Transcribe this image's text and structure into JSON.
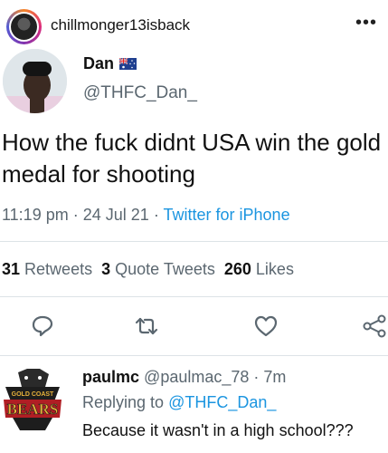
{
  "instagram": {
    "username": "chillmonger13isback",
    "more_icon": "more-horizontal-icon"
  },
  "tweet": {
    "name": "Dan",
    "flag": "australia-flag",
    "handle": "@THFC_Dan_",
    "text": "How the fuck didnt USA win the gold medal for shooting",
    "time": "11:19 pm",
    "sep1": "·",
    "date": "24 Jul 21",
    "sep2": "·",
    "source": "Twitter for iPhone",
    "retweets_count": "31",
    "retweets_label": "Retweets",
    "quotes_count": "3",
    "quotes_label": "Quote Tweets",
    "likes_count": "260",
    "likes_label": "Likes"
  },
  "actions": [
    "reply-icon",
    "retweet-icon",
    "like-icon",
    "share-icon"
  ],
  "reply": {
    "name": "paulmc",
    "handle": "@paulmac_78",
    "sep": "·",
    "time": "7m",
    "replying_prefix": "Replying to",
    "replying_to": "@THFC_Dan_",
    "text": "Because it wasn't in a high school???",
    "avatar_text_top": "GOLD COAST",
    "avatar_text_main": "BEARS"
  },
  "colors": {
    "link": "#1b95e0",
    "secondary_text": "#5b6770",
    "divider": "#dde3e7"
  }
}
